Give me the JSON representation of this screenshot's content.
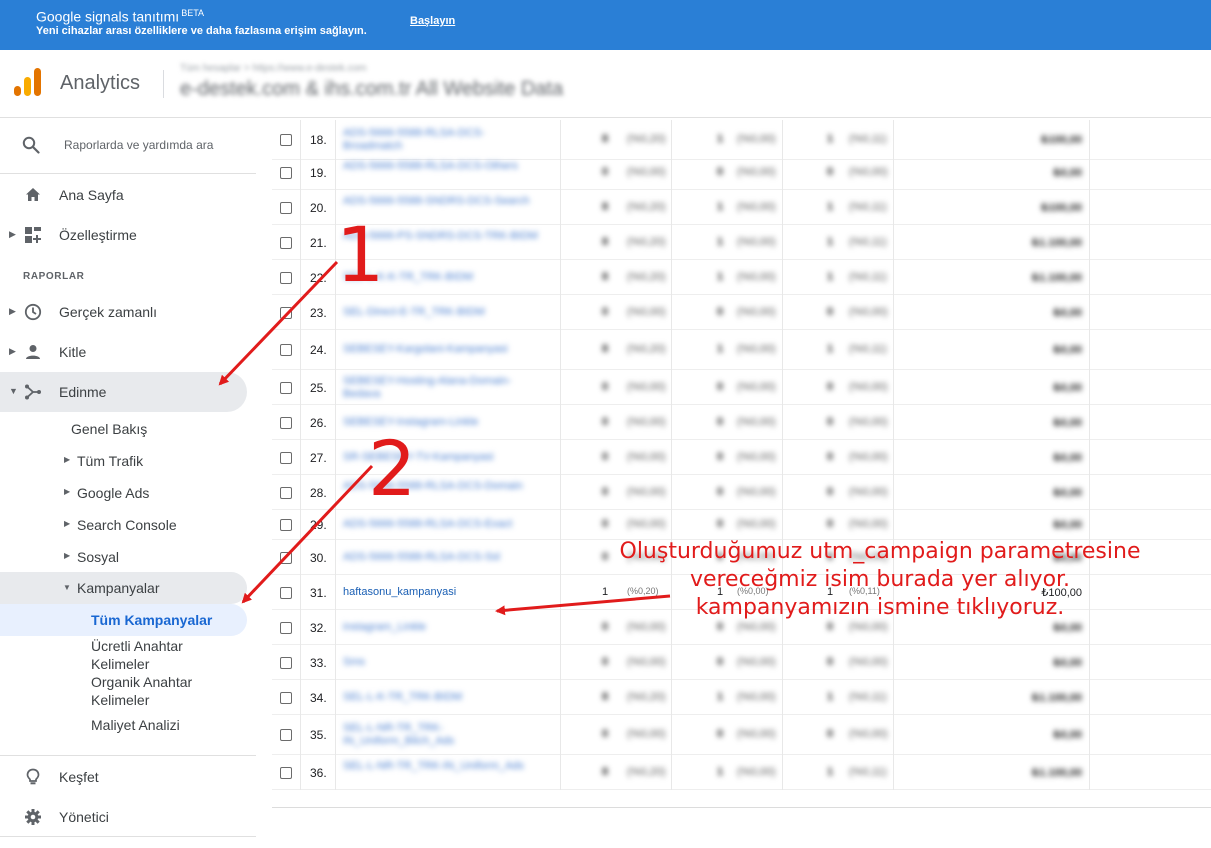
{
  "banner": {
    "title": "Google signals tanıtımı",
    "badge": "BETA",
    "subtitle": "Yeni cihazlar arası özelliklere ve daha fazlasına erişim sağlayın.",
    "cta": "Başlayın",
    "background": "#2a7fd6"
  },
  "header": {
    "app_name": "Analytics",
    "account_breadcrumb": "Tüm hesaplar > https://www.e-destek.com",
    "property_name": "e-destek.com & ihs.com.tr All Website Data"
  },
  "sidebar": {
    "search_placeholder": "Raporlarda ve yardımda ara",
    "home": "Ana Sayfa",
    "customization": "Özelleştirme",
    "reports_section": "RAPORLAR",
    "realtime": "Gerçek zamanlı",
    "audience": "Kitle",
    "acquisition": "Edinme",
    "acquisition_children": {
      "overview": "Genel Bakış",
      "all_traffic": "Tüm Trafik",
      "google_ads": "Google Ads",
      "search_console": "Search Console",
      "social": "Sosyal",
      "campaigns": "Kampanyalar",
      "campaign_children": {
        "all_campaigns": "Tüm Kampanyalar",
        "paid_keywords": "Ücretli Anahtar Kelimeler",
        "organic_keywords": "Organik Anahtar Kelimeler",
        "cost_analysis": "Maliyet Analizi"
      }
    },
    "discover": "Keşfet",
    "admin": "Yönetici"
  },
  "table": {
    "rows": [
      {
        "n": "18.",
        "name": "ADS-5666-5588-RLSA-DCS-Broadmatch",
        "c1": "8",
        "p1": "(%0,20)",
        "c2": "1",
        "p2": "(%0,00)",
        "c3": "1",
        "p3": "(%0,11)",
        "rev": "₺100,00"
      },
      {
        "n": "19.",
        "name": "ADS-5666-5588-RLSA-DCS-Others",
        "c1": "0",
        "p1": "(%0,00)",
        "c2": "0",
        "p2": "(%0,00)",
        "c3": "0",
        "p3": "(%0,00)",
        "rev": "₺0,00"
      },
      {
        "n": "20.",
        "name": "ADS-5666-5588-SNDRS-DCS-Search",
        "c1": "8",
        "p1": "(%0,20)",
        "c2": "1",
        "p2": "(%0,00)",
        "c3": "1",
        "p3": "(%0,11)",
        "rev": "₺100,00"
      },
      {
        "n": "21.",
        "name": "ADS-5666-PS-SNDRS-DCS-TRK-BIDM",
        "c1": "8",
        "p1": "(%0,20)",
        "c2": "1",
        "p2": "(%0,00)",
        "c3": "1",
        "p3": "(%0,11)",
        "rev": "₺1.100,00"
      },
      {
        "n": "22.",
        "name": "SEL-L-K-K-TR_TRK-BIDM",
        "c1": "8",
        "p1": "(%0,20)",
        "c2": "1",
        "p2": "(%0,00)",
        "c3": "1",
        "p3": "(%0,11)",
        "rev": "₺1.100,00"
      },
      {
        "n": "23.",
        "name": "SEL-Direct-E-TR_TRK-BIDM",
        "c1": "0",
        "p1": "(%0,00)",
        "c2": "0",
        "p2": "(%0,00)",
        "c3": "0",
        "p3": "(%0,00)",
        "rev": "₺0,00"
      },
      {
        "n": "24.",
        "name": "SEBESEY-Kargolani-Kampanyasi",
        "c1": "8",
        "p1": "(%0,20)",
        "c2": "1",
        "p2": "(%0,00)",
        "c3": "1",
        "p3": "(%0,11)",
        "rev": "₺0,00"
      },
      {
        "n": "25.",
        "name": "SEBESEY-Hosting-Alana-Domain-Bedava",
        "c1": "0",
        "p1": "(%0,00)",
        "c2": "0",
        "p2": "(%0,00)",
        "c3": "0",
        "p3": "(%0,00)",
        "rev": "₺0,00"
      },
      {
        "n": "26.",
        "name": "SEBESEY-Instagram-Linkle",
        "c1": "0",
        "p1": "(%0,00)",
        "c2": "0",
        "p2": "(%0,00)",
        "c3": "0",
        "p3": "(%0,00)",
        "rev": "₺0,00"
      },
      {
        "n": "27.",
        "name": "SR-SEBESEY-TV-Kampanyasi",
        "c1": "0",
        "p1": "(%0,00)",
        "c2": "0",
        "p2": "(%0,00)",
        "c3": "0",
        "p3": "(%0,00)",
        "rev": "₺0,00"
      },
      {
        "n": "28.",
        "name": "ADS-5666-5588-RLSA-DCS-Domain",
        "c1": "0",
        "p1": "(%0,00)",
        "c2": "0",
        "p2": "(%0,00)",
        "c3": "0",
        "p3": "(%0,00)",
        "rev": "₺0,00"
      },
      {
        "n": "29.",
        "name": "ADS-5666-5588-RLSA-DCS-Exact",
        "c1": "0",
        "p1": "(%0,00)",
        "c2": "0",
        "p2": "(%0,00)",
        "c3": "0",
        "p3": "(%0,00)",
        "rev": "₺0,00"
      },
      {
        "n": "30.",
        "name": "ADS-5666-5588-RLSA-DCS-Ssl",
        "c1": "0",
        "p1": "(%0,00)",
        "c2": "0",
        "p2": "(%0,00)",
        "c3": "0",
        "p3": "(%0,00)",
        "rev": "₺0,00"
      },
      {
        "n": "31.",
        "name": "haftasonu_kampanyasi",
        "c1": "1",
        "p1": "(%0,20)",
        "c2": "1",
        "p2": "(%0,00)",
        "c3": "1",
        "p3": "(%0,11)",
        "rev": "₺100,00",
        "clear": true
      },
      {
        "n": "32.",
        "name": "instagram_Linkle",
        "c1": "0",
        "p1": "(%0,00)",
        "c2": "0",
        "p2": "(%0,00)",
        "c3": "0",
        "p3": "(%0,00)",
        "rev": "₺0,00"
      },
      {
        "n": "33.",
        "name": "Sms",
        "c1": "0",
        "p1": "(%0,00)",
        "c2": "0",
        "p2": "(%0,00)",
        "c3": "0",
        "p3": "(%0,00)",
        "rev": "₺0,00"
      },
      {
        "n": "34.",
        "name": "SEL-L-K-TR_TRK-BIDM",
        "c1": "8",
        "p1": "(%0,20)",
        "c2": "1",
        "p2": "(%0,00)",
        "c3": "1",
        "p3": "(%0,11)",
        "rev": "₺1.100,00"
      },
      {
        "n": "35.",
        "name": "SEL-L-NR-TR_TRK-IN_Uniform_Bitch_Ads",
        "c1": "0",
        "p1": "(%0,00)",
        "c2": "0",
        "p2": "(%0,00)",
        "c3": "0",
        "p3": "(%0,00)",
        "rev": "₺0,00"
      },
      {
        "n": "36.",
        "name": "SEL-L-NR-TR_TRK-IN_Uniform_Ads",
        "c1": "8",
        "p1": "(%0,20)",
        "c2": "1",
        "p2": "(%0,00)",
        "c3": "1",
        "p3": "(%0,11)",
        "rev": "₺1.100,00"
      }
    ]
  },
  "annotations": {
    "marker_1": "1",
    "marker_2": "2",
    "note_line1": "Oluşturduğumuz utm_campaign parametresine",
    "note_line2": "vereceğmiz isim burada yer alıyor.",
    "note_line3": "kampanyamızın ismine tıklıyoruz.",
    "color": "#e11b1b"
  }
}
